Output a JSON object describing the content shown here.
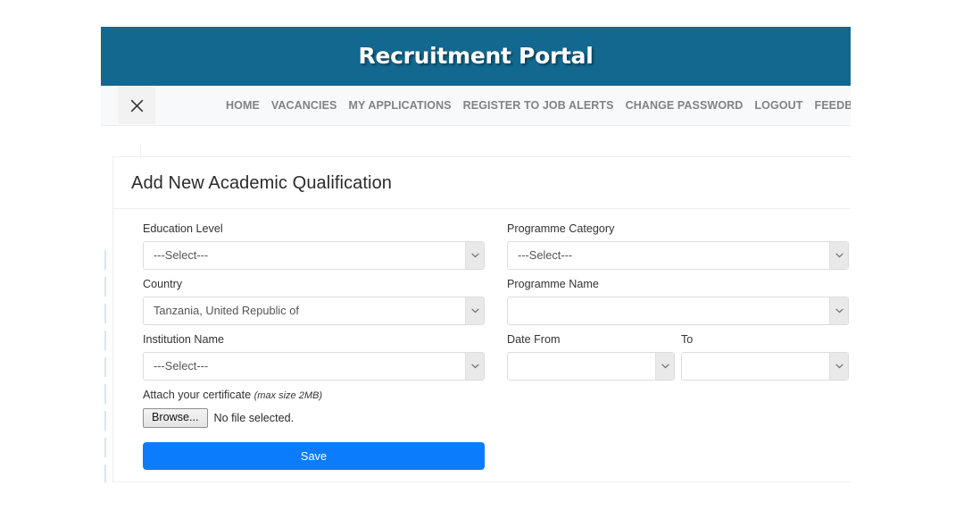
{
  "header": {
    "title": "Recruitment Portal",
    "brand_color": "#12688f"
  },
  "nav": {
    "close_icon": "close-icon",
    "items": [
      {
        "label": "HOME"
      },
      {
        "label": "VACANCIES"
      },
      {
        "label": "MY APPLICATIONS"
      },
      {
        "label": "REGISTER TO JOB ALERTS"
      },
      {
        "label": "CHANGE PASSWORD"
      },
      {
        "label": "LOGOUT"
      },
      {
        "label": "FEEDBACK"
      }
    ]
  },
  "card": {
    "title": "Add New Academic Qualification"
  },
  "form": {
    "education_level": {
      "label": "Education Level",
      "value": "---Select---"
    },
    "country": {
      "label": "Country",
      "value": "Tanzania, United Republic of"
    },
    "institution_name": {
      "label": "Institution Name",
      "value": "---Select---"
    },
    "programme_category": {
      "label": "Programme Category",
      "value": "---Select---"
    },
    "programme_name": {
      "label": "Programme Name",
      "value": ""
    },
    "date_from": {
      "label": "Date From",
      "value": ""
    },
    "date_to": {
      "label": "To",
      "value": ""
    },
    "attachment": {
      "label": "Attach your certificate",
      "note": "(max size 2MB)",
      "browse_label": "Browse...",
      "status": "No file selected."
    },
    "save_label": "Save",
    "save_color": "#0b7cfb"
  }
}
